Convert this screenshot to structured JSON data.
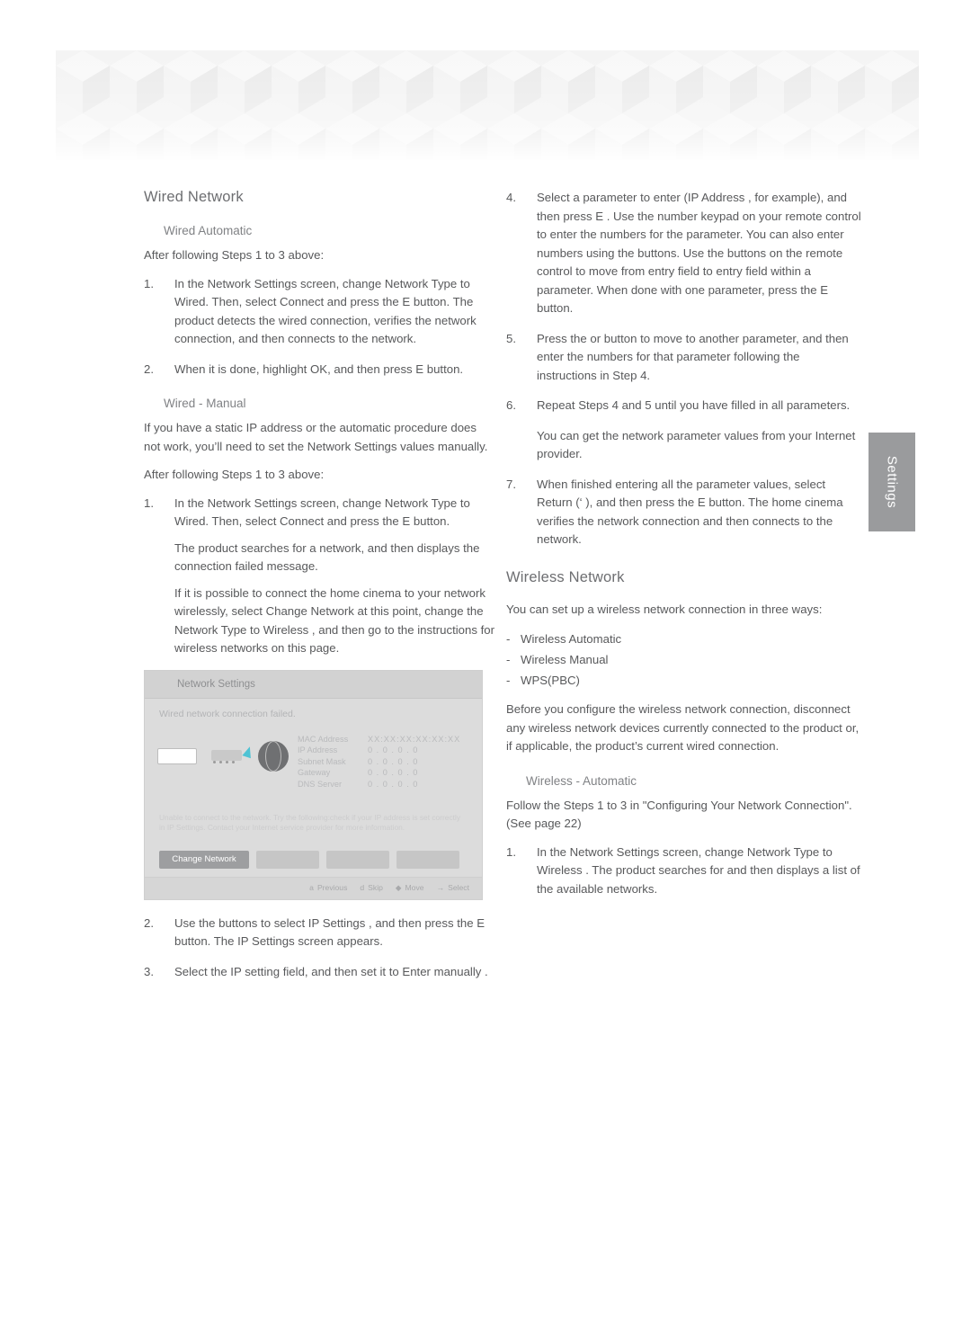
{
  "side_tab": {
    "label": "Settings"
  },
  "left": {
    "heading": "Wired Network",
    "sub_auto": "Wired   Automatic",
    "after_steps_1": "After following Steps 1 to 3 above:",
    "auto_steps": [
      {
        "num": "1.",
        "paras": [
          "In the Network Settings  screen, change Network Type  to Wired. Then, select Connect and press the E    button. The product detects the wired connection, verifies the network connection, and then connects to the network."
        ]
      },
      {
        "num": "2.",
        "paras": [
          "When it is done, highlight OK, and then press E    button."
        ]
      }
    ],
    "sub_manual": "Wired - Manual",
    "manual_intro": "If you have a static IP address or the automatic procedure does not work, you’ll need to set the Network Settings  values manually.",
    "after_steps_2": "After following Steps 1 to 3 above:",
    "manual_steps": [
      {
        "num": "1.",
        "paras": [
          "In the Network Settings  screen, change Network Type  to Wired. Then, select Connect and press the E    button.",
          "The product searches for a network, and then displays the connection failed message.",
          "If it is possible to connect the home cinema to your network wirelessly, select Change Network  at this point, change the Network Type  to Wireless , and then go to the instructions for wireless networks on this page."
        ]
      }
    ],
    "manual_steps_after_image": [
      {
        "num": "2.",
        "paras": [
          "Use the   buttons to select     IP Settings , and then press the E    button. The IP Settings screen appears."
        ]
      },
      {
        "num": "3.",
        "paras": [
          "Select the IP setting  field, and then set it to Enter manually ."
        ]
      }
    ]
  },
  "tv_screen": {
    "title": "Network Settings",
    "fail_message": "Wired network connection failed.",
    "net_rows": [
      {
        "key": "MAC Address",
        "value": "XX:XX:XX:XX:XX:XX"
      },
      {
        "key": "IP Address",
        "value": "0 .  0 .  0 .  0"
      },
      {
        "key": "Subnet Mask",
        "value": "0 .  0 .  0 .  0"
      },
      {
        "key": "Gateway",
        "value": "0 .  0 .  0 .  0"
      },
      {
        "key": "DNS Server",
        "value": "0 .  0 .  0 .  0"
      }
    ],
    "info_message": "Unable to connect to the network. Try the following:check if your IP address is set correctly in IP Settings. Contact your Internet service provider for more information.",
    "buttons": {
      "change_network": "Change Network"
    },
    "footer": [
      {
        "icon": "a",
        "label": "Previous"
      },
      {
        "icon": "d",
        "label": "Skip"
      },
      {
        "icon": "◆",
        "label": "Move"
      },
      {
        "icon": "→",
        "label": "Select"
      }
    ]
  },
  "right": {
    "steps_cont": [
      {
        "num": "4.",
        "paras": [
          "Select a parameter to enter (IP Address , for example), and then press E  . Use the number keypad on your remote control to enter the numbers for the parameter. You can also enter numbers using the   buttons. Use the   buttons on the remote control to move from entry field to entry field within a parameter. When done with one parameter, press the E    button."
        ]
      },
      {
        "num": "5.",
        "paras": [
          "Press the   or   button to move to another parameter, and then enter the numbers for that parameter following the instructions in Step 4."
        ]
      },
      {
        "num": "6.",
        "paras": [
          "Repeat Steps 4 and 5 until you have filled in all parameters."
        ]
      }
    ],
    "note": "You can get the network parameter values from your Internet provider.",
    "step7": {
      "num": "7.",
      "paras": [
        "When finished entering all the parameter values, select Return  (‘  ), and then press the E    button. The home cinema verifies the network connection and then connects to the network."
      ]
    },
    "heading": "Wireless Network",
    "intro": "You can set up a wireless network connection in three ways:",
    "ways": [
      "Wireless Automatic",
      "Wireless Manual",
      "WPS(PBC)"
    ],
    "before_note": "Before you configure the wireless network connection, disconnect any wireless network devices currently connected to the product or, if applicable, the product’s current wired connection.",
    "sub_auto": "Wireless - Automatic",
    "follow": "Follow the Steps 1 to 3 in \"Configuring Your Network Connection\". (See page 22)",
    "auto_steps": [
      {
        "num": "1.",
        "paras": [
          "In the Network Settings  screen, change Network Type  to Wireless . The product searches for and then displays a list of the available networks."
        ]
      }
    ]
  }
}
